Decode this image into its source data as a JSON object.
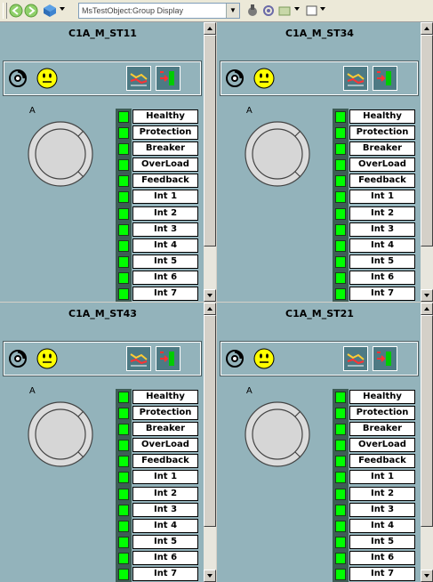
{
  "toolbar": {
    "address_value": "MsTestObject:Group Display",
    "icons": [
      "back-icon",
      "forward-icon",
      "object-icon",
      "tools-icon",
      "settings-icon",
      "view-icon",
      "window-icon"
    ]
  },
  "panels": [
    {
      "title": "C1A_M_ST11",
      "label_a": "A"
    },
    {
      "title": "C1A_M_ST34",
      "label_a": "A"
    },
    {
      "title": "C1A_M_ST43",
      "label_a": "A"
    },
    {
      "title": "C1A_M_ST21",
      "label_a": "A"
    }
  ],
  "status_labels": [
    "Healthy",
    "Protection",
    "Breaker",
    "OverLoad",
    "Feedback",
    "Int 1",
    "Int 2",
    "Int 3",
    "Int 4",
    "Int 5",
    "Int 6",
    "Int 7"
  ],
  "colors": {
    "panel_bg": "#93b3bb",
    "led_on": "#00ff00",
    "smiley": "#ffff00",
    "tool_button": "#4d7a84"
  }
}
